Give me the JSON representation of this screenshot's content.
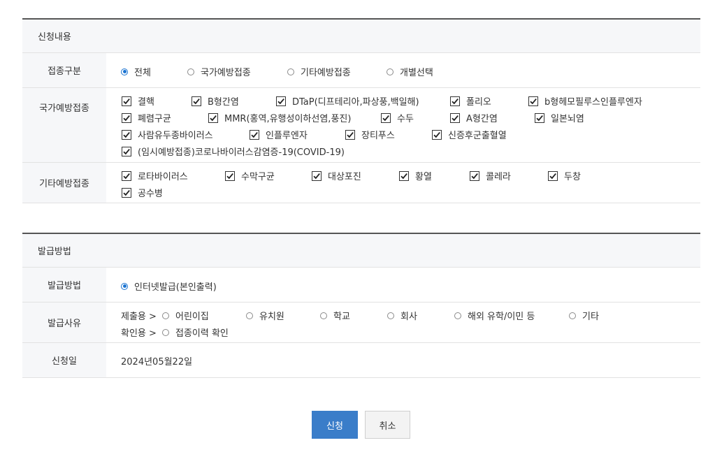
{
  "section1": {
    "title": "신청내용",
    "rows": {
      "category": {
        "label": "접종구분",
        "options": [
          "전체",
          "국가예방접종",
          "기타예방접종",
          "개별선택"
        ],
        "selected": "전체"
      },
      "national": {
        "label": "국가예방접종",
        "items": [
          "결핵",
          "B형간염",
          "DTaP(디프테리아,파상풍,백일해)",
          "폴리오",
          "b형헤모필루스인플루엔자",
          "폐렴구균",
          "MMR(홍역,유행성이하선염,풍진)",
          "수두",
          "A형간염",
          "일본뇌염",
          "사람유두종바이러스",
          "인플루엔자",
          "장티푸스",
          "신증후군출혈열",
          "(임시예방접종)코로나바이러스감염증-19(COVID-19)"
        ]
      },
      "other": {
        "label": "기타예방접종",
        "items": [
          "로타바이러스",
          "수막구균",
          "대상포진",
          "황열",
          "콜레라",
          "두창",
          "공수병"
        ]
      }
    }
  },
  "section2": {
    "title": "발급방법",
    "rows": {
      "method": {
        "label": "발급방법",
        "option": "인터넷발급(본인출력)"
      },
      "reason": {
        "label": "발급사유",
        "submit_prefix": "제출용 >",
        "submit_options": [
          "어린이집",
          "유치원",
          "학교",
          "회사",
          "해외 유학/이민 등",
          "기타"
        ],
        "confirm_prefix": "확인용 >",
        "confirm_options": [
          "접종이력 확인"
        ]
      },
      "date": {
        "label": "신청일",
        "value": "2024년05월22일"
      }
    }
  },
  "buttons": {
    "submit": "신청",
    "cancel": "취소"
  },
  "colors": {
    "accent": "#3a7dc9",
    "radio_selected": "#1a73d1",
    "header_bg": "#f6f7f9"
  }
}
